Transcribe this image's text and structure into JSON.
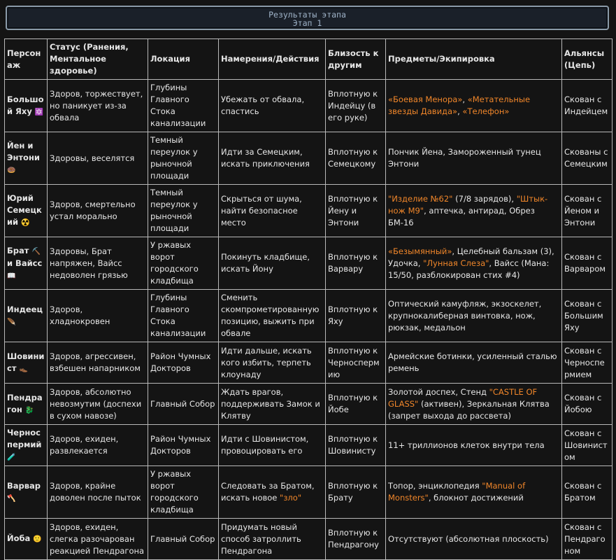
{
  "header": {
    "title": "Результаты этапа",
    "subtitle": "Этап 1"
  },
  "columns": [
    "Персонаж",
    "Статус (Ранения, Ментальное здоровье)",
    "Локация",
    "Намерения/Действия",
    "Близость к другим",
    "Предметы/Экипировка",
    "Альянсы (Цепь)"
  ],
  "rows": [
    {
      "name": "Большой Яху",
      "icon": "🔯",
      "status": "Здоров, торжествует, но паникует из-за обвала",
      "location": "Глубины Главного Стока канализации",
      "intent": "Убежать от обвала, спастись",
      "proximity": "Вплотную к Индейцу (в его руке)",
      "items": [
        {
          "t": "«Боевая Менора»",
          "h": true
        },
        {
          "t": ", ",
          "h": false
        },
        {
          "t": "«Метательные звезды Давида»",
          "h": true
        },
        {
          "t": ", ",
          "h": false
        },
        {
          "t": "«Телефон»",
          "h": true
        }
      ],
      "alliance": "Скован с Индейцем"
    },
    {
      "name": "Йен и Энтони",
      "icon": "🍩",
      "status": "Здоровы, веселятся",
      "location": "Темный переулок у рыночной площади",
      "intent": "Идти за Семецким, искать приключения",
      "proximity": "Вплотную к Семецкому",
      "items": [
        {
          "t": "Пончик Йена, Замороженный тунец Энтони",
          "h": false
        }
      ],
      "alliance": "Скованы с Семецким"
    },
    {
      "name": "Юрий Семецкий",
      "icon": "☢️",
      "status": "Здоров, смертельно устал морально",
      "location": "Темный переулок у рыночной площади",
      "intent": "Скрыться от шума, найти безопасное место",
      "proximity": "Вплотную к Йену и Энтони",
      "items": [
        {
          "t": "\"Изделие №62\"",
          "h": true
        },
        {
          "t": " (7/8 зарядов), ",
          "h": false
        },
        {
          "t": "\"Штык-нож М9\"",
          "h": true
        },
        {
          "t": ", аптечка, антирад, Обрез БМ-16",
          "h": false
        }
      ],
      "alliance": "Скован с Йеном и Энтони"
    },
    {
      "name": "Брат",
      "icon": "⛏️",
      "name2": "и Вайсс",
      "icon2": "📖",
      "status": "Здоровы, Брат напряжен, Вайсс недоволен грязью",
      "location": "У ржавых ворот городского кладбища",
      "intent": "Покинуть кладбище, искать Йону",
      "proximity": "Вплотную к Варвару",
      "items": [
        {
          "t": "«Безымянный»",
          "h": true
        },
        {
          "t": ", Целебный бальзам (3), Удочка, ",
          "h": false
        },
        {
          "t": "\"Лунная Слеза\"",
          "h": true
        },
        {
          "t": ", Вайсс (Мана: 15/50, разблокирован стих #4)",
          "h": false
        }
      ],
      "alliance": "Скован с Варваром"
    },
    {
      "name": "Индеец",
      "icon": "🪶",
      "status": "Здоров, хладнокровен",
      "location": "Глубины Главного Стока канализации",
      "intent": "Сменить скомпрометированную позицию, выжить при обвале",
      "proximity": "Вплотную к Яху",
      "items": [
        {
          "t": "Оптический камуфляж, экзоскелет, крупнокалиберная винтовка, нож, рюкзак, медальон",
          "h": false
        }
      ],
      "alliance": "Скован с Большим Яху"
    },
    {
      "name": "Шовинист",
      "icon": "👞",
      "status": "Здоров, агрессивен, взбешен напарником",
      "location": "Район Чумных Докторов",
      "intent": "Идти дальше, искать кого избить, терпеть клоунаду",
      "proximity": "Вплотную к Черноспермию",
      "items": [
        {
          "t": "Армейские ботинки, усиленный сталью ремень",
          "h": false
        }
      ],
      "alliance": "Скован с Черноспермием"
    },
    {
      "name": "Пендрагон",
      "icon": "🐉",
      "status": "Здоров, абсолютно невозмутим (доспехи в сухом навозе)",
      "location": "Главный Собор",
      "intent": "Ждать врагов, поддерживать Замок и Клятву",
      "proximity": "Вплотную к Йобе",
      "items": [
        {
          "t": "Золотой доспех, Стенд ",
          "h": false
        },
        {
          "t": "\"CASTLE OF GLASS\"",
          "h": true
        },
        {
          "t": " (активен), Зеркальная Клятва (запрет выхода до рассвета)",
          "h": false
        }
      ],
      "alliance": "Скован с Йобою"
    },
    {
      "name": "Черноспермий",
      "icon": "🧪",
      "status": "Здоров, ехиден, развлекается",
      "location": "Район Чумных Докторов",
      "intent": "Идти с Шовинистом, провоцировать его",
      "proximity": "Вплотную к Шовинисту",
      "items": [
        {
          "t": "11+ триллионов клеток внутри тела",
          "h": false
        }
      ],
      "alliance": "Скован с Шовинистом"
    },
    {
      "name": "Варвар",
      "icon": "🪓",
      "status": "Здоров, крайне доволен после пыток",
      "location": "У ржавых ворот городского кладбища",
      "intent_parts": [
        {
          "t": "Следовать за Братом, искать новое ",
          "h": false
        },
        {
          "t": "\"зло\"",
          "h": true
        }
      ],
      "proximity": "Вплотную к Брату",
      "items": [
        {
          "t": "Топор, энциклопедия ",
          "h": false
        },
        {
          "t": "\"Manual of Monsters\"",
          "h": true
        },
        {
          "t": ", блокнот достижений",
          "h": false
        }
      ],
      "alliance": "Скован с Братом"
    },
    {
      "name": "Йоба",
      "icon": "🙂",
      "status": "Здоров, ехиден, слегка разочарован реакцией Пендрагона",
      "location": "Главный Собор",
      "intent": "Придумать новый способ затроллить Пендрагона",
      "proximity": "Вплотную к Пендрагону",
      "items": [
        {
          "t": "Отсутствуют (абсолютная плоскость)",
          "h": false
        }
      ],
      "alliance": "Скован с Пендрагоном"
    }
  ]
}
